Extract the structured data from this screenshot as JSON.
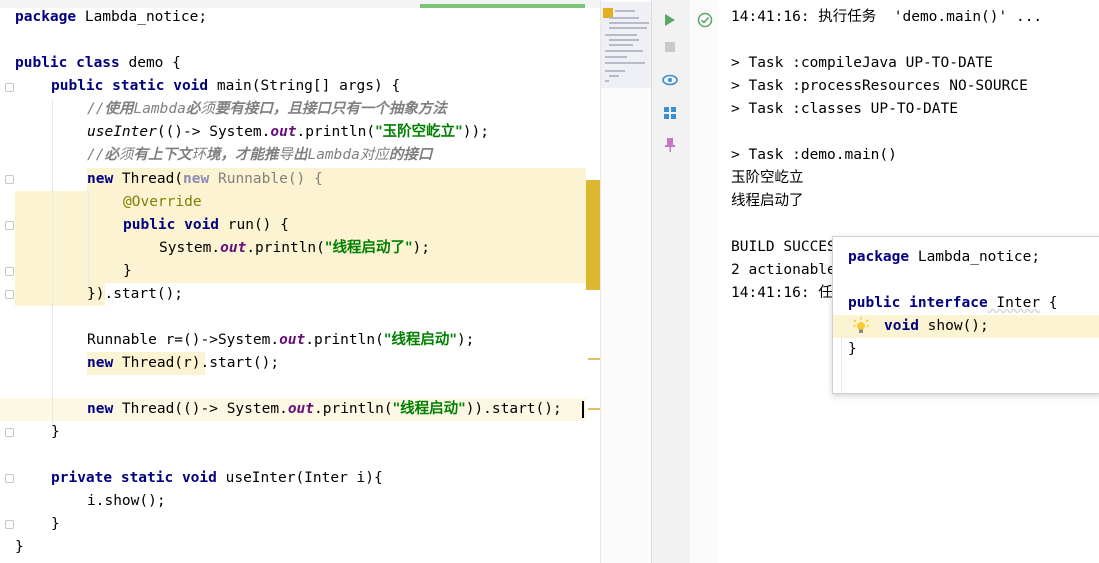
{
  "editor": {
    "package_kw": "package",
    "package_name": " Lambda_notice;",
    "class_decl": {
      "kw": "public class",
      "name": " demo {"
    },
    "main_decl": {
      "kw": "public static void",
      "rest": " main(String[] args) {"
    },
    "comment1": {
      "slashes": "//",
      "b1": "使用",
      "p1": "Lambda",
      "b2": "必",
      "p2": "须",
      "b3": "要有接口，且接口只有一个抽象方法"
    },
    "useinter_line": {
      "call": "useInter",
      "mid": "(()-> System.",
      "field": "out",
      "tail1": ".println(",
      "str": "\"玉阶空屹立\"",
      "tail2": "));"
    },
    "comment2": {
      "slashes": "//",
      "b1": "必",
      "p1": "须",
      "b2": "有上下文",
      "p2": "环",
      "b3": "境，才能推",
      "p3": "导",
      "b4": "出",
      "p4": "Lambda",
      "p5": "对应",
      "b5": "的接口"
    },
    "thread_line": {
      "kw": "new",
      "rest": " Thread(",
      "kw2": "new",
      "gray": " Runnable() {"
    },
    "override": "@Override",
    "run_decl": {
      "kw": "public void",
      "rest": " run() {"
    },
    "println_line": {
      "pre": "System.",
      "field": "out",
      "mid": ".println(",
      "str": "\"线程启动了\"",
      "tail": ");"
    },
    "close_brace": "}",
    "start_line": "}).start();",
    "runnable_line": {
      "pre": "Runnable r=()->System.",
      "field": "out",
      "mid": ".println(",
      "str": "\"线程启动\"",
      "tail": ");"
    },
    "thread_r_line": {
      "kw": "new",
      "rest": " Thread(r).start();"
    },
    "thread_lambda_line": {
      "kw": "new",
      "mid": " Thread(()-> System.",
      "field": "out",
      "mid2": ".println(",
      "str": "\"线程启动\"",
      "tail": ")).start();"
    },
    "method_close": "}",
    "useinter_decl": {
      "kw": "private static void",
      "rest": " useInter(Inter i){"
    },
    "show_call": "i.show();",
    "useinter_close": "}",
    "class_close": "}"
  },
  "console": {
    "lines": [
      "14:41:16: 执行任务  'demo.main()' ...",
      "",
      "> Task :compileJava UP-TO-DATE",
      "> Task :processResources NO-SOURCE",
      "> Task :classes UP-TO-DATE",
      "",
      "> Task :demo.main()",
      "玉阶空屹立",
      "线程启动了",
      "",
      "BUILD SUCCES",
      "2 actionable",
      "14:41:16: 任"
    ]
  },
  "popup": {
    "package_kw": "package",
    "package_name": " Lambda_notice;",
    "interface_kw": "public interface",
    "interface_name": " Inter",
    "brace_open": " {",
    "method_kw": "void",
    "method_rest": " show();",
    "brace_close": "}"
  },
  "toolbar_icons": [
    "run-icon",
    "stop-icon",
    "eye-icon",
    "layout-icon",
    "pin-icon"
  ],
  "colors": {
    "keyword": "#000080",
    "string": "#008000",
    "field": "#660e7a",
    "comment": "#808080",
    "annotation": "#808000",
    "highlight": "#fbf3d1",
    "run_green": "#59a869"
  }
}
